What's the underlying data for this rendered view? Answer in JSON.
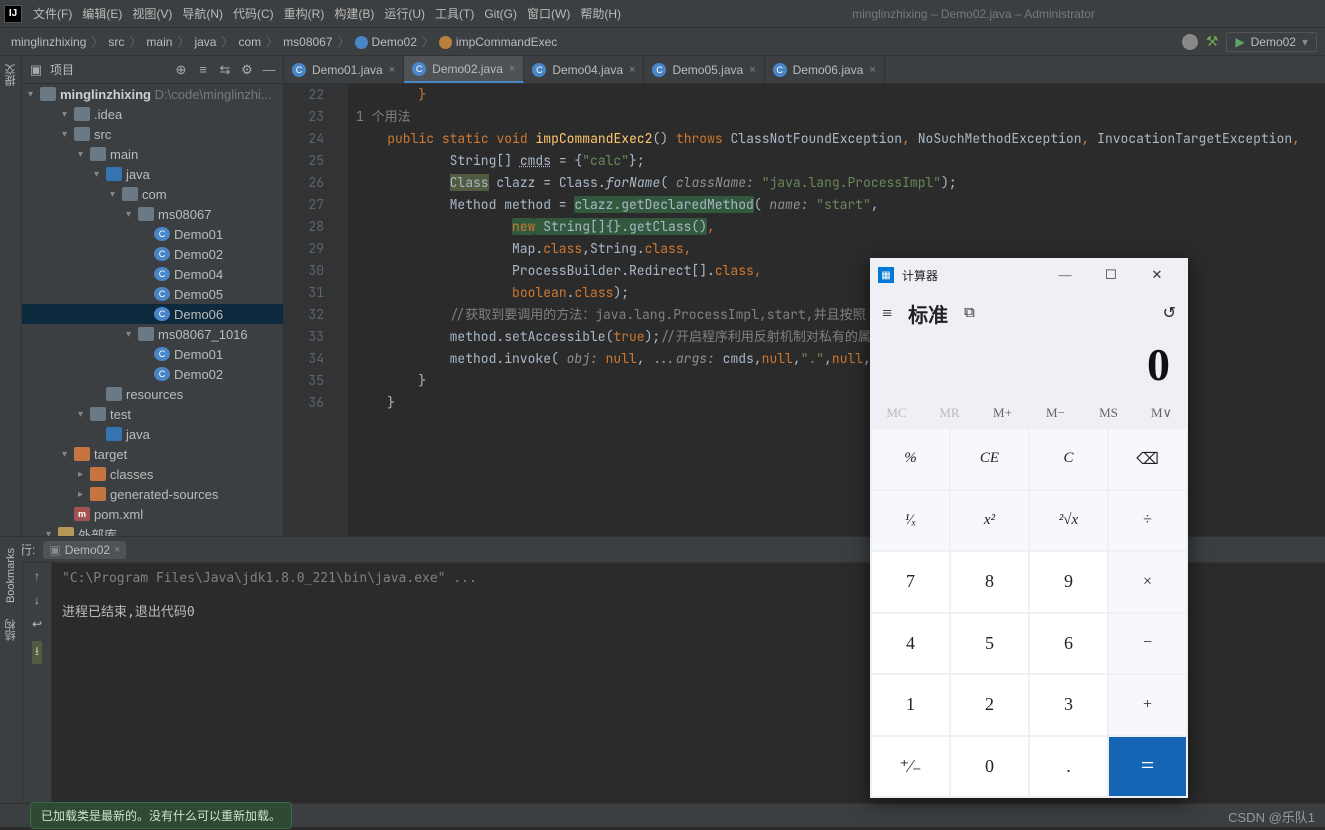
{
  "menubar": {
    "items": [
      "文件(F)",
      "编辑(E)",
      "视图(V)",
      "导航(N)",
      "代码(C)",
      "重构(R)",
      "构建(B)",
      "运行(U)",
      "工具(T)",
      "Git(G)",
      "窗口(W)",
      "帮助(H)"
    ],
    "title": "minglinzhixing – Demo02.java – Administrator"
  },
  "breadcrumb": {
    "parts": [
      "minglinzhixing",
      "src",
      "main",
      "java",
      "com",
      "ms08067",
      "Demo02",
      "impCommandExec"
    ],
    "runconf": "Demo02"
  },
  "project": {
    "label": "项目",
    "root": {
      "name": "minglinzhixing",
      "path": "D:\\code\\minglinzhi..."
    },
    "tree": [
      {
        "depth": 1,
        "arrow": "▾",
        "icon": "folder",
        "label": ".idea"
      },
      {
        "depth": 1,
        "arrow": "▾",
        "icon": "folder",
        "label": "src"
      },
      {
        "depth": 2,
        "arrow": "▾",
        "icon": "folder",
        "label": "main"
      },
      {
        "depth": 3,
        "arrow": "▾",
        "icon": "folder-b",
        "label": "java"
      },
      {
        "depth": 4,
        "arrow": "▾",
        "icon": "folder",
        "label": "com"
      },
      {
        "depth": 5,
        "arrow": "▾",
        "icon": "folder",
        "label": "ms08067"
      },
      {
        "depth": 6,
        "arrow": " ",
        "icon": "clazz",
        "label": "Demo01"
      },
      {
        "depth": 6,
        "arrow": " ",
        "icon": "clazz",
        "label": "Demo02"
      },
      {
        "depth": 6,
        "arrow": " ",
        "icon": "clazz",
        "label": "Demo04"
      },
      {
        "depth": 6,
        "arrow": " ",
        "icon": "clazz",
        "label": "Demo05"
      },
      {
        "depth": 6,
        "arrow": " ",
        "icon": "clazz",
        "label": "Demo06",
        "sel": true
      },
      {
        "depth": 5,
        "arrow": "▾",
        "icon": "folder",
        "label": "ms08067_1016"
      },
      {
        "depth": 6,
        "arrow": " ",
        "icon": "clazz",
        "label": "Demo01"
      },
      {
        "depth": 6,
        "arrow": " ",
        "icon": "clazz",
        "label": "Demo02"
      },
      {
        "depth": 3,
        "arrow": " ",
        "icon": "folder",
        "label": "resources"
      },
      {
        "depth": 2,
        "arrow": "▾",
        "icon": "folder",
        "label": "test"
      },
      {
        "depth": 3,
        "arrow": " ",
        "icon": "folder-b",
        "label": "java"
      },
      {
        "depth": 1,
        "arrow": "▾",
        "icon": "folder-o",
        "label": "target"
      },
      {
        "depth": 2,
        "arrow": "▸",
        "icon": "folder-o",
        "label": "classes"
      },
      {
        "depth": 2,
        "arrow": "▸",
        "icon": "folder-o",
        "label": "generated-sources"
      },
      {
        "depth": 1,
        "arrow": " ",
        "icon": "mvn",
        "label": "pom.xml"
      },
      {
        "depth": 0,
        "arrow": "▾",
        "icon": "lib",
        "label": "外部库"
      }
    ]
  },
  "tabs": [
    {
      "label": "Demo01.java",
      "active": false,
      "icon": "clazz"
    },
    {
      "label": "Demo02.java",
      "active": true,
      "icon": "clazz"
    },
    {
      "label": "Demo04.java",
      "active": false,
      "icon": "clazz"
    },
    {
      "label": "Demo05.java",
      "active": false,
      "icon": "clazz"
    },
    {
      "label": "Demo06.java",
      "active": false,
      "icon": "clazz"
    }
  ],
  "gutter": [
    "22",
    "",
    "",
    "23",
    "24",
    "25",
    "26",
    "27",
    "",
    "",
    "",
    "28",
    "29",
    "30",
    "31",
    "32",
    "33",
    "34",
    "35",
    "36"
  ],
  "code_usage": "1 个用法",
  "code_tokens": {
    "l22": "}",
    "l23": [
      "public",
      "static",
      "void",
      "impCommandExec2",
      "()",
      "throws",
      "ClassNotFoundException",
      ",",
      "NoSuchMethodException",
      ",",
      "InvocationTargetException",
      ","
    ],
    "l24": [
      "String[] ",
      "cmds",
      " = {",
      "\"calc\"",
      "};"
    ],
    "l25": [
      "Class",
      " clazz = Class.",
      "forName",
      "( ",
      "className:",
      " ",
      "\"java.lang.ProcessImpl\"",
      ");"
    ],
    "l26": [
      "Method method = ",
      "clazz.getDeclaredMethod",
      "( ",
      "name:",
      " ",
      "\"start\"",
      ","
    ],
    "l27": [
      "new",
      " String[]{}.getClass()",
      ","
    ],
    "l28": [
      "Map.",
      "class",
      ",String.",
      "class",
      ","
    ],
    "l29": [
      "ProcessBuilder.Redirect[].",
      "class",
      ","
    ],
    "l30": [
      "boolean",
      ".",
      "class",
      ");"
    ],
    "l31": [
      "//获取到要调用的方法：java.lang.ProcessImpl,start,并且按照"
    ],
    "l32": [
      "method.setAccessible(",
      "true",
      ");",
      "//开启程序利用反射机制对私有的属"
    ],
    "l33": [
      "method.invoke( ",
      "obj:",
      " ",
      "null",
      ", ",
      "...args:",
      " cmds,",
      "null",
      ",",
      "\".\"",
      ",",
      "null",
      ",",
      "true"
    ],
    "l34": "}",
    "l35": "}"
  },
  "run": {
    "label": "运行:",
    "name": "Demo02",
    "line1": "\"C:\\Program Files\\Java\\jdk1.8.0_221\\bin\\java.exe\" ...",
    "line2": "进程已结束,退出代码0"
  },
  "toast": "已加载类是最新的。没有什么可以重新加载。",
  "watermark": "CSDN @乐队1",
  "sidetabs": {
    "left1": "提交",
    "bookmarks": "Bookmarks",
    "structure": "结构"
  },
  "calc": {
    "title": "计算器",
    "mode": "标准",
    "display": "0",
    "mem": [
      "MC",
      "MR",
      "M+",
      "M−",
      "MS",
      "M∨"
    ],
    "grid": [
      [
        "%",
        "CE",
        "C",
        "⌫"
      ],
      [
        "¹⁄ₓ",
        "x²",
        "²√x",
        "÷"
      ],
      [
        "7",
        "8",
        "9",
        "×"
      ],
      [
        "4",
        "5",
        "6",
        "−"
      ],
      [
        "1",
        "2",
        "3",
        "+"
      ],
      [
        "⁺⁄₋",
        "0",
        ".",
        "="
      ]
    ]
  }
}
